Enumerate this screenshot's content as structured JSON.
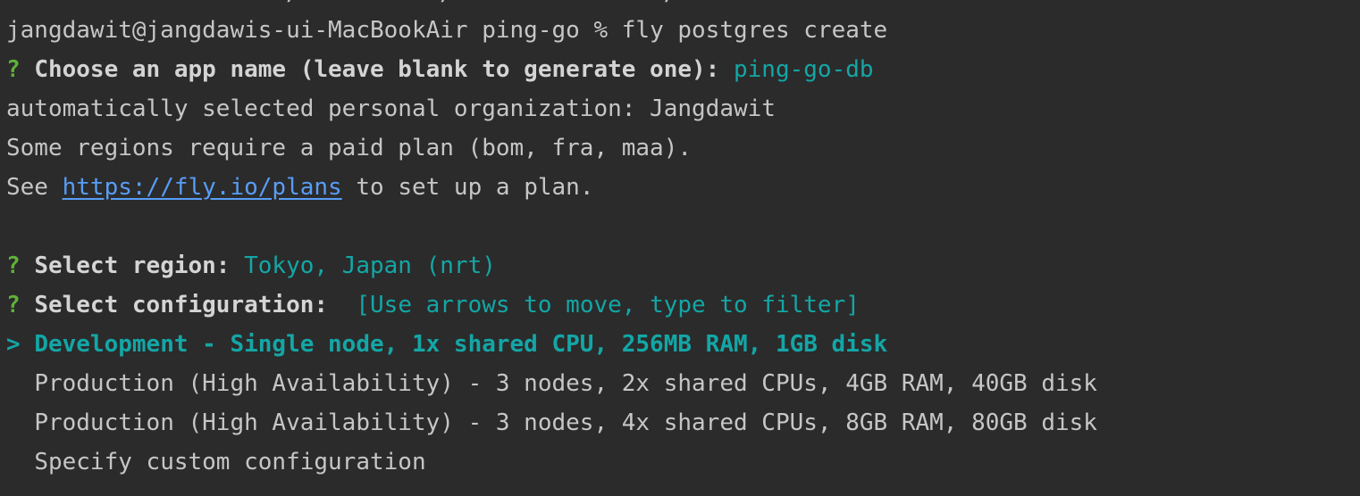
{
  "terminal": {
    "clipped_top_line": "                    /          /               /  ",
    "prompt": {
      "user_host": "jangdawit@jangdawis-ui-MacBookAir",
      "dir": "ping-go",
      "symbol": "%",
      "command": "fly postgres create"
    },
    "q1": {
      "mark": "?",
      "question": "Choose an app name (leave blank to generate one):",
      "answer": "ping-go-db"
    },
    "info1": "automatically selected personal organization: Jangdawit",
    "info2": "Some regions require a paid plan (bom, fra, maa).",
    "info3": {
      "pre": "See",
      "link": "https://fly.io/plans",
      "post": "to set up a plan."
    },
    "q2": {
      "mark": "?",
      "question": "Select region:",
      "answer": "Tokyo, Japan (nrt)"
    },
    "q3": {
      "mark": "?",
      "question": "Select configuration:",
      "hint": "[Use arrows to move, type to filter]"
    },
    "options": {
      "cursor": ">",
      "selected": "Development - Single node, 1x shared CPU, 256MB RAM, 1GB disk",
      "opt2": "Production (High Availability) - 3 nodes, 2x shared CPUs, 4GB RAM, 40GB disk",
      "opt3": "Production (High Availability) - 3 nodes, 4x shared CPUs, 8GB RAM, 80GB disk",
      "opt4": "Specify custom configuration"
    },
    "colors": {
      "background": "#2b2b2b",
      "text": "#c6c6c6",
      "question_mark": "#5fb13a",
      "accent_cyan": "#14a6a6",
      "link": "#589df6"
    }
  }
}
